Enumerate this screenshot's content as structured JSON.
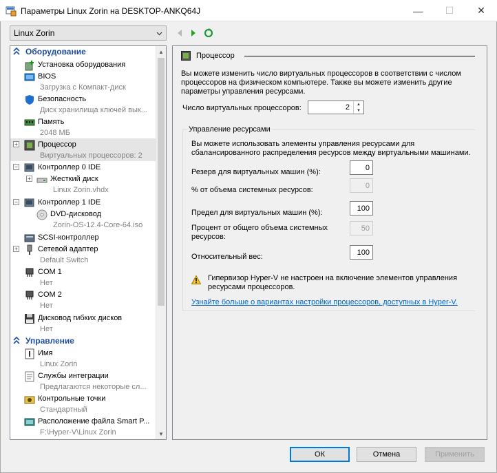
{
  "window": {
    "title": "Параметры Linux Zorin на DESKTOP-ANKQ64J",
    "minimize": "—",
    "maximize": "☐",
    "close": "✕"
  },
  "vm_selector": {
    "value": "Linux Zorin"
  },
  "tree": {
    "hardware_header": "Оборудование",
    "management_header": "Управление",
    "items": [
      {
        "label": "Установка оборудования",
        "sub": ""
      },
      {
        "label": "BIOS",
        "sub": "Загрузка с Компакт-диск"
      },
      {
        "label": "Безопасность",
        "sub": "Диск хранилища ключей вык..."
      },
      {
        "label": "Память",
        "sub": "2048 МБ"
      },
      {
        "label": "Процессор",
        "sub": "Виртуальных процессоров: 2"
      },
      {
        "label": "Контроллер 0 IDE",
        "sub": ""
      },
      {
        "label": "Жесткий диск",
        "sub": "Linux Zorin.vhdx"
      },
      {
        "label": "Контроллер 1 IDE",
        "sub": ""
      },
      {
        "label": "DVD-дисковод",
        "sub": "Zorin-OS-12.4-Core-64.iso"
      },
      {
        "label": "SCSI-контроллер",
        "sub": ""
      },
      {
        "label": "Сетевой адаптер",
        "sub": "Default Switch"
      },
      {
        "label": "COM 1",
        "sub": "Нет"
      },
      {
        "label": "COM 2",
        "sub": "Нет"
      },
      {
        "label": "Дисковод гибких дисков",
        "sub": "Нет"
      },
      {
        "label": "Имя",
        "sub": "Linux Zorin"
      },
      {
        "label": "Службы интеграции",
        "sub": "Предлагаются некоторые сл..."
      },
      {
        "label": "Контрольные точки",
        "sub": "Стандартный"
      },
      {
        "label": "Расположение файла Smart P...",
        "sub": "F:\\Hyper-V\\Linux Zorin"
      }
    ]
  },
  "panel": {
    "title": "Процессор",
    "description": "Вы можете изменить число виртуальных процессоров в соответствии с числом процессоров на физическом компьютере. Также вы можете изменить другие параметры управления ресурсами.",
    "vproc_label": "Число виртуальных процессоров:",
    "vproc_value": "2",
    "group_title": "Управление ресурсами",
    "group_desc": "Вы можете использовать элементы управления ресурсами для сбалансированного распределения ресурсов между виртуальными машинами.",
    "reserve_label": "Резерв для виртуальных машин (%):",
    "reserve_value": "0",
    "reserve_sys_label": "% от объема системных ресурсов:",
    "reserve_sys_value": "0",
    "limit_label": "Предел для виртуальных машин (%):",
    "limit_value": "100",
    "limit_sys_label": "Процент от общего объема системных ресурсов:",
    "limit_sys_value": "50",
    "weight_label": "Относительный вес:",
    "weight_value": "100",
    "warning": "Гипервизор Hyper-V не настроен на включение элементов управления ресурсами процессоров.",
    "link": "Узнайте больше о вариантах настройки процессоров, доступных в Hyper-V."
  },
  "buttons": {
    "ok": "ОК",
    "cancel": "Отмена",
    "apply": "Применить"
  }
}
